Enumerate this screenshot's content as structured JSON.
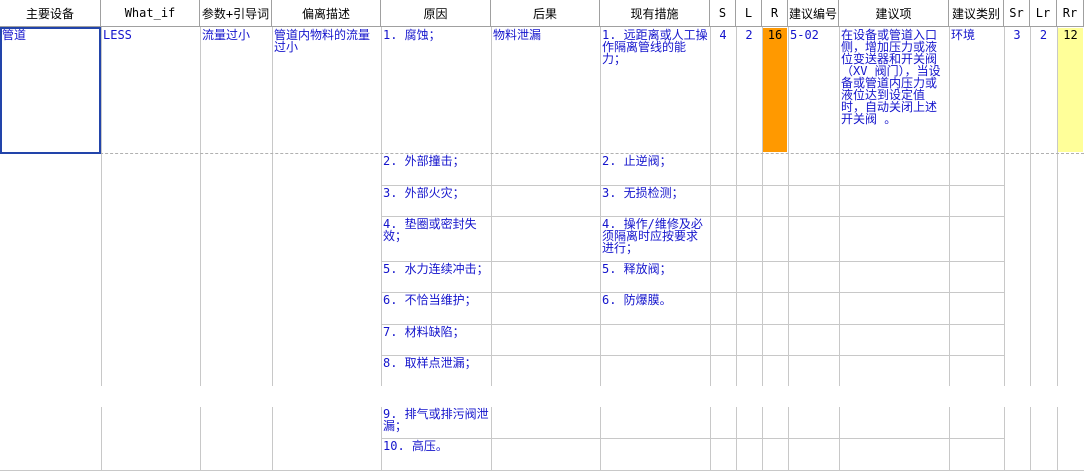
{
  "headers": [
    "主要设备",
    "What_if",
    "参数+引导词",
    "偏离描述",
    "原因",
    "后果",
    "现有措施",
    "S",
    "L",
    "R",
    "建议编号",
    "建议项",
    "建议类别",
    "Sr",
    "Lr",
    "Rr"
  ],
  "row": {
    "equipment": "管道",
    "what_if": "LESS",
    "param": "流量过小",
    "deviation": "管道内物料的流量过小",
    "cause1": "1. 腐蚀；",
    "consequence": "物料泄漏",
    "measure1": "1. 远距离或人工操作隔离管线的能力；",
    "S": "4",
    "L": "2",
    "R": "16",
    "rec_no": "5-02",
    "recommendation": "在设备或管道入口侧，增加压力或液位变送器和开关阀（XV 阀门），当设备或管道内压力或液位达到设定值时，自动关闭上述开关阀 。",
    "rec_category": "环境",
    "Sr": "3",
    "Lr": "2",
    "Rr": "12"
  },
  "causes": [
    "2. 外部撞击；",
    "3. 外部火灾；",
    "4. 垫圈或密封失效；",
    "5. 水力连续冲击；",
    "6. 不恰当维护；",
    "7. 材料缺陷；",
    "8. 取样点泄漏；",
    "9. 排气或排污阀泄漏；",
    "10. 高压。"
  ],
  "measures": [
    "2. 止逆阀；",
    "3. 无损检测；",
    "4. 操作/维修及必须隔离时应按要求进行；",
    "5. 释放阀；",
    "6. 防爆膜。"
  ],
  "colors": {
    "risk_high": "#ff9900",
    "risk_residual": "#ffff99",
    "text": "#1414cc",
    "selection": "#2244aa"
  }
}
